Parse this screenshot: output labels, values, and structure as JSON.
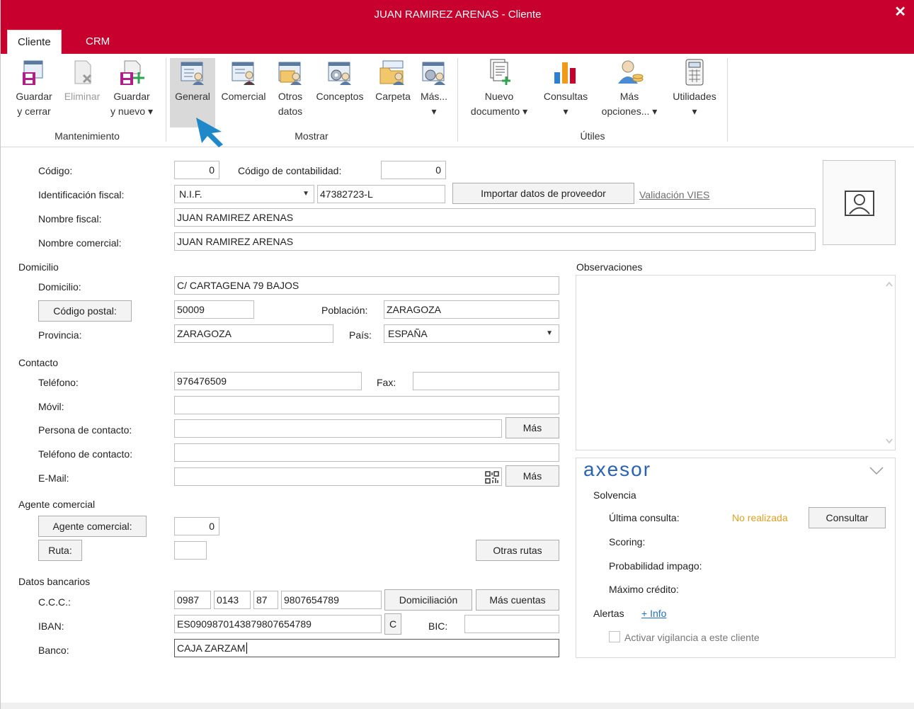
{
  "window": {
    "title": "JUAN RAMIREZ ARENAS - Cliente",
    "close": "✕"
  },
  "tabs": [
    {
      "label": "Cliente"
    },
    {
      "label": "CRM"
    }
  ],
  "ribbon": {
    "mantenimiento": {
      "label": "Mantenimiento",
      "guardar_cerrar": [
        "Guardar",
        "y cerrar"
      ],
      "eliminar": "Eliminar",
      "guardar_nuevo": [
        "Guardar",
        "y nuevo ▾"
      ]
    },
    "mostrar": {
      "label": "Mostrar",
      "general": "General",
      "comercial": "Comercial",
      "otros_datos": [
        "Otros",
        "datos"
      ],
      "conceptos": "Conceptos",
      "carpeta": "Carpeta",
      "mas": [
        "Más...",
        "▾"
      ]
    },
    "utiles": {
      "label": "Útiles",
      "nuevo_documento": [
        "Nuevo",
        "documento ▾"
      ],
      "consultas": [
        "Consultas",
        "▾"
      ],
      "mas_opciones": [
        "Más",
        "opciones... ▾"
      ],
      "utilidades": [
        "Utilidades",
        "▾"
      ]
    }
  },
  "form": {
    "codigo": {
      "label": "Código:",
      "value": "0"
    },
    "codigo_contabilidad": {
      "label": "Código de contabilidad:",
      "value": "0"
    },
    "identificacion_fiscal": {
      "label": "Identificación fiscal:",
      "type": "N.I.F.",
      "value": "47382723-L"
    },
    "importar_btn": "Importar datos de proveedor",
    "validacion_vies": "Validación VIES",
    "nombre_fiscal": {
      "label": "Nombre fiscal:",
      "value": "JUAN RAMIREZ ARENAS"
    },
    "nombre_comercial": {
      "label": "Nombre comercial:",
      "value": "JUAN RAMIREZ ARENAS"
    },
    "domicilio_section": "Domicilio",
    "domicilio": {
      "label": "Domicilio:",
      "value": "C/ CARTAGENA 79 BAJOS"
    },
    "codigo_postal": {
      "label": "Código postal:",
      "value": "50009"
    },
    "poblacion": {
      "label": "Población:",
      "value": "ZARAGOZA"
    },
    "provincia": {
      "label": "Provincia:",
      "value": "ZARAGOZA"
    },
    "pais": {
      "label": "País:",
      "value": "ESPAÑA"
    },
    "contacto_section": "Contacto",
    "telefono": {
      "label": "Teléfono:",
      "value": "976476509"
    },
    "fax": {
      "label": "Fax:",
      "value": ""
    },
    "movil": {
      "label": "Móvil:",
      "value": ""
    },
    "persona_contacto": {
      "label": "Persona de contacto:",
      "value": ""
    },
    "telefono_contacto": {
      "label": "Teléfono de contacto:",
      "value": ""
    },
    "email": {
      "label": "E-Mail:",
      "value": ""
    },
    "mas_btn": "Más",
    "agente_section": "Agente comercial",
    "agente_comercial": {
      "label": "Agente comercial:",
      "value": "0"
    },
    "ruta": {
      "label": "Ruta:",
      "value": ""
    },
    "otras_rutas_btn": "Otras rutas",
    "bancarios_section": "Datos bancarios",
    "ccc": {
      "label": "C.C.C.:",
      "entidad": "0987",
      "oficina": "0143",
      "dc": "87",
      "cuenta": "9807654789"
    },
    "domiciliacion_btn": "Domiciliación",
    "mas_cuentas_btn": "Más cuentas",
    "iban": {
      "label": "IBAN:",
      "value": "ES0909870143879807654789"
    },
    "c_btn": "C",
    "bic": {
      "label": "BIC:",
      "value": ""
    },
    "banco": {
      "label": "Banco:",
      "value": "CAJA ZARZAM"
    },
    "observaciones": {
      "label": "Observaciones"
    }
  },
  "axesor": {
    "logo": "axesor",
    "solvencia": "Solvencia",
    "ultima_consulta": {
      "label": "Última consulta:",
      "value": "No realizada"
    },
    "consultar_btn": "Consultar",
    "scoring": "Scoring:",
    "probabilidad": "Probabilidad impago:",
    "maximo_credito": "Máximo crédito:",
    "alertas": "Alertas",
    "info_link": "+ Info",
    "vigilancia": "Activar vigilancia a este cliente"
  },
  "colors": {
    "brand": "#c8002d",
    "accent": "#1e88c8",
    "warning": "#e0a020"
  }
}
